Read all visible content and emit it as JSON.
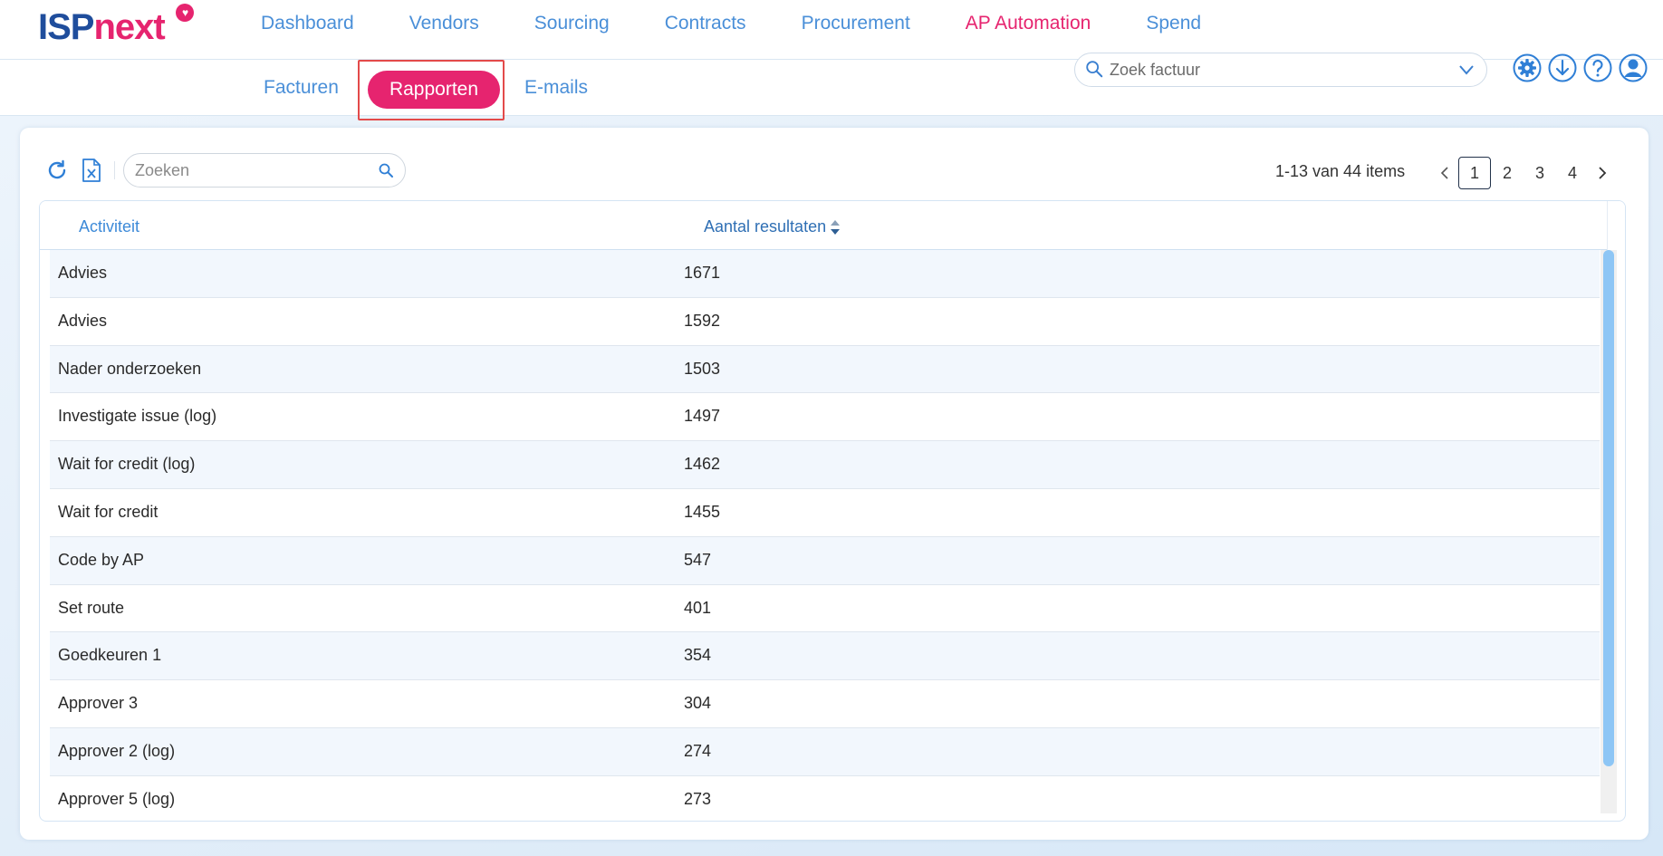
{
  "brand": {
    "part1": "ISP",
    "part2": "next",
    "heart": "♥"
  },
  "main_nav": [
    {
      "label": "Dashboard",
      "active": false
    },
    {
      "label": "Vendors",
      "active": false
    },
    {
      "label": "Sourcing",
      "active": false
    },
    {
      "label": "Contracts",
      "active": false
    },
    {
      "label": "Procurement",
      "active": false
    },
    {
      "label": "AP Automation",
      "active": true
    },
    {
      "label": "Spend",
      "active": false
    }
  ],
  "sub_nav": {
    "facturen": "Facturen",
    "rapporten": "Rapporten",
    "emails": "E-mails"
  },
  "global_search": {
    "placeholder": "Zoek factuur"
  },
  "top_icons": [
    "gear-icon",
    "download-icon",
    "help-icon",
    "user-icon"
  ],
  "toolbar": {
    "search_placeholder": "Zoeken",
    "refresh_icon": "refresh-icon",
    "excel_icon": "excel-export-icon"
  },
  "pager": {
    "info": "1-13 van 44 items",
    "pages": [
      "1",
      "2",
      "3",
      "4"
    ],
    "current": "1"
  },
  "table": {
    "columns": [
      "Activiteit",
      "Aantal resultaten"
    ],
    "rows": [
      [
        "Advies",
        "1671"
      ],
      [
        "Advies",
        "1592"
      ],
      [
        "Nader onderzoeken",
        "1503"
      ],
      [
        "Investigate issue (log)",
        "1497"
      ],
      [
        "Wait for credit (log)",
        "1462"
      ],
      [
        "Wait for credit",
        "1455"
      ],
      [
        "Code by AP",
        "547"
      ],
      [
        "Set route",
        "401"
      ],
      [
        "Goedkeuren 1",
        "354"
      ],
      [
        "Approver 3",
        "304"
      ],
      [
        "Approver 2 (log)",
        "274"
      ],
      [
        "Approver 5 (log)",
        "273"
      ]
    ]
  },
  "colors": {
    "brand_blue": "#1f4d9c",
    "brand_pink": "#e6246f",
    "link_blue": "#4a8fd8",
    "highlight_red": "#e34a4a"
  }
}
